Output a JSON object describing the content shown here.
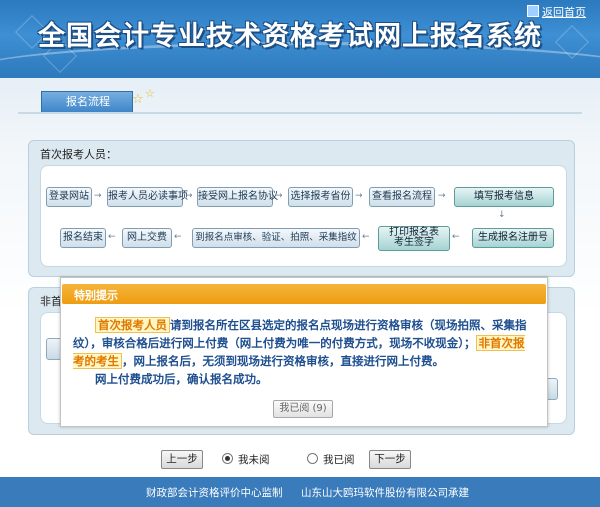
{
  "header": {
    "title": "全国会计专业技术资格考试网上报名系统",
    "back_link": "返回首页"
  },
  "tab": {
    "label": "报名流程"
  },
  "section1": {
    "title": "首次报考人员：",
    "row1": [
      "登录网站",
      "报考人员必读事项",
      "接受网上报名协议",
      "选择报考省份",
      "查看报名流程",
      "填写报考信息"
    ],
    "row2": [
      "报名结束",
      "网上交费",
      "到报名点审核、验证、拍照、采集指纹",
      "打印报名表",
      "考生签字",
      "生成报名注册号"
    ]
  },
  "section2": {
    "title": "非首次报考人员："
  },
  "dialog": {
    "title": "特别提示",
    "hl1": "首次报考人员",
    "p1a": "请到报名所在区县选定的报名点现场进行资格审核（现场拍照、采集指纹），审核合格后进行网上付费（网上付费为唯一的付费方式，现场不收现金）；",
    "hl2": "非首次报考的考生",
    "p1b": "，网上报名后，无须到现场进行资格审核，直接进行网上付费。",
    "p2": "网上付费成功后，确认报名成功。",
    "button": "我已阅 (9)"
  },
  "bottom": {
    "prev": "上一步",
    "not_read": "我未阅",
    "read": "我已阅",
    "next": "下一步",
    "selected": "not_read"
  },
  "footer": {
    "left": "财政部会计资格评价中心监制",
    "right": "山东山大鸥玛软件股份有限公司承建"
  }
}
